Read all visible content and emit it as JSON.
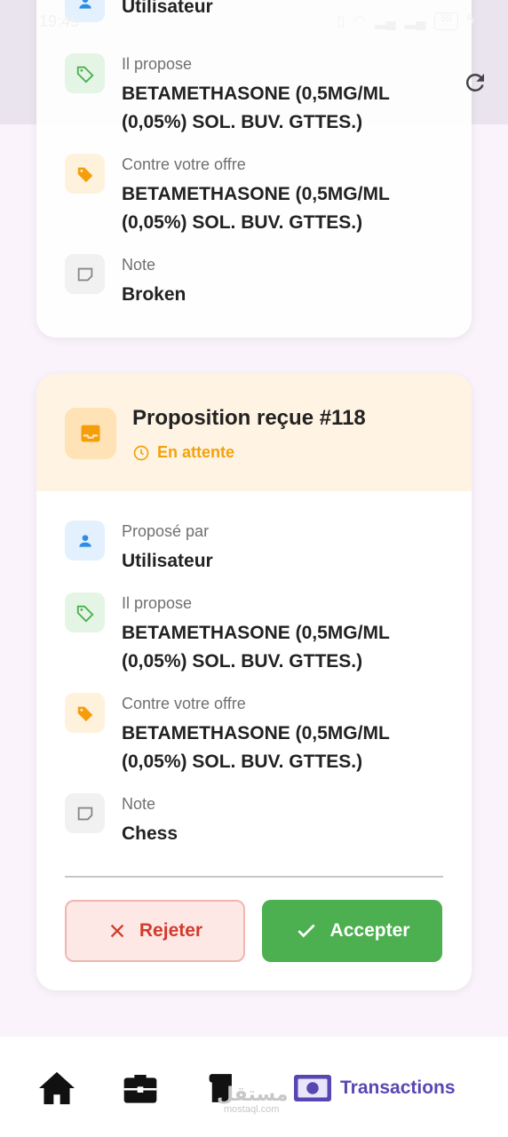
{
  "status_bar": {
    "time": "19:45",
    "battery": "55"
  },
  "top_card": {
    "rows": [
      {
        "label": "",
        "value": "Utilisateur",
        "icon": "person-icon"
      },
      {
        "label": "Il propose",
        "value": "BETAMETHASONE (0,5MG/ML (0,05%) SOL. BUV. GTTES.)",
        "icon": "tag-icon"
      },
      {
        "label": "Contre votre offre",
        "value": "BETAMETHASONE (0,5MG/ML (0,05%) SOL. BUV. GTTES.)",
        "icon": "tag-filled-icon"
      },
      {
        "label": "Note",
        "value": "Broken",
        "icon": "note-icon"
      }
    ]
  },
  "main_card": {
    "title": "Proposition reçue #118",
    "status": "En attente",
    "rows": [
      {
        "label": "Proposé par",
        "value": "Utilisateur",
        "icon": "person-icon"
      },
      {
        "label": "Il propose",
        "value": "BETAMETHASONE (0,5MG/ML (0,05%) SOL. BUV. GTTES.)",
        "icon": "tag-icon"
      },
      {
        "label": "Contre votre offre",
        "value": "BETAMETHASONE (0,5MG/ML (0,05%) SOL. BUV. GTTES.)",
        "icon": "tag-filled-icon"
      },
      {
        "label": "Note",
        "value": "Chess",
        "icon": "note-icon"
      }
    ],
    "reject_label": "Rejeter",
    "accept_label": "Accepter"
  },
  "bottom_nav": {
    "items": [
      {
        "icon": "home-icon",
        "label": ""
      },
      {
        "icon": "briefcase-icon",
        "label": ""
      },
      {
        "icon": "scroll-icon",
        "label": ""
      },
      {
        "icon": "money-icon",
        "label": "Transactions"
      }
    ],
    "watermark": "مستقل",
    "watermark_sub": "mostaql.com"
  },
  "colors": {
    "accent": "#5847b3",
    "pending": "#f2a20c",
    "accept": "#4caf50",
    "reject": "#d23a2c"
  }
}
